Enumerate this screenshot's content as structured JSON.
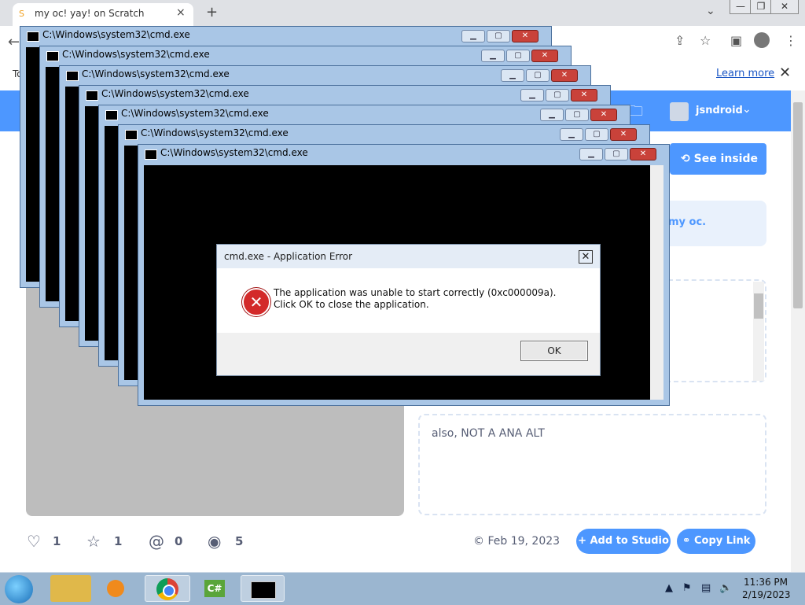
{
  "browser": {
    "tab_title": "my oc! yay! on Scratch",
    "tab_close": "×",
    "new_tab": "+",
    "info_bar_text": "To",
    "learn_more": "Learn more",
    "info_close": "✕"
  },
  "scratch": {
    "username": "jsndroid",
    "see_inside": "See inside",
    "remix_text": "my oc.",
    "notes_text": "also, NOT A ANA ALT",
    "loves": "1",
    "favorites": "1",
    "remixes": "0",
    "views": "5",
    "date": "Feb 19, 2023",
    "add_to_studio": "Add to Studio",
    "copy_link": "Copy Link"
  },
  "cmd_windows": [
    {
      "title": "C:\\Windows\\system32\\cmd.exe"
    },
    {
      "title": "C:\\Windows\\system32\\cmd.exe"
    },
    {
      "title": "C:\\Windows\\system32\\cmd.exe"
    },
    {
      "title": "C:\\Windows\\system32\\cmd.exe"
    },
    {
      "title": "C:\\Windows\\system32\\cmd.exe"
    },
    {
      "title": "C:\\Windows\\system32\\cmd.exe"
    },
    {
      "title": "C:\\Windows\\system32\\cmd.exe"
    }
  ],
  "error_dialog": {
    "title": "cmd.exe - Application Error",
    "message": "The application was unable to start correctly (0xc000009a). Click OK to close the application.",
    "ok": "OK",
    "close": "✕"
  },
  "taskbar": {
    "clock_time": "11:36 PM",
    "clock_date": "2/19/2023",
    "tray_chevron": "▲"
  },
  "colors": {
    "scratch_blue": "#4d97ff",
    "taskbar": "#9bb6d0",
    "cmd_frame": "#a9c6e6"
  }
}
